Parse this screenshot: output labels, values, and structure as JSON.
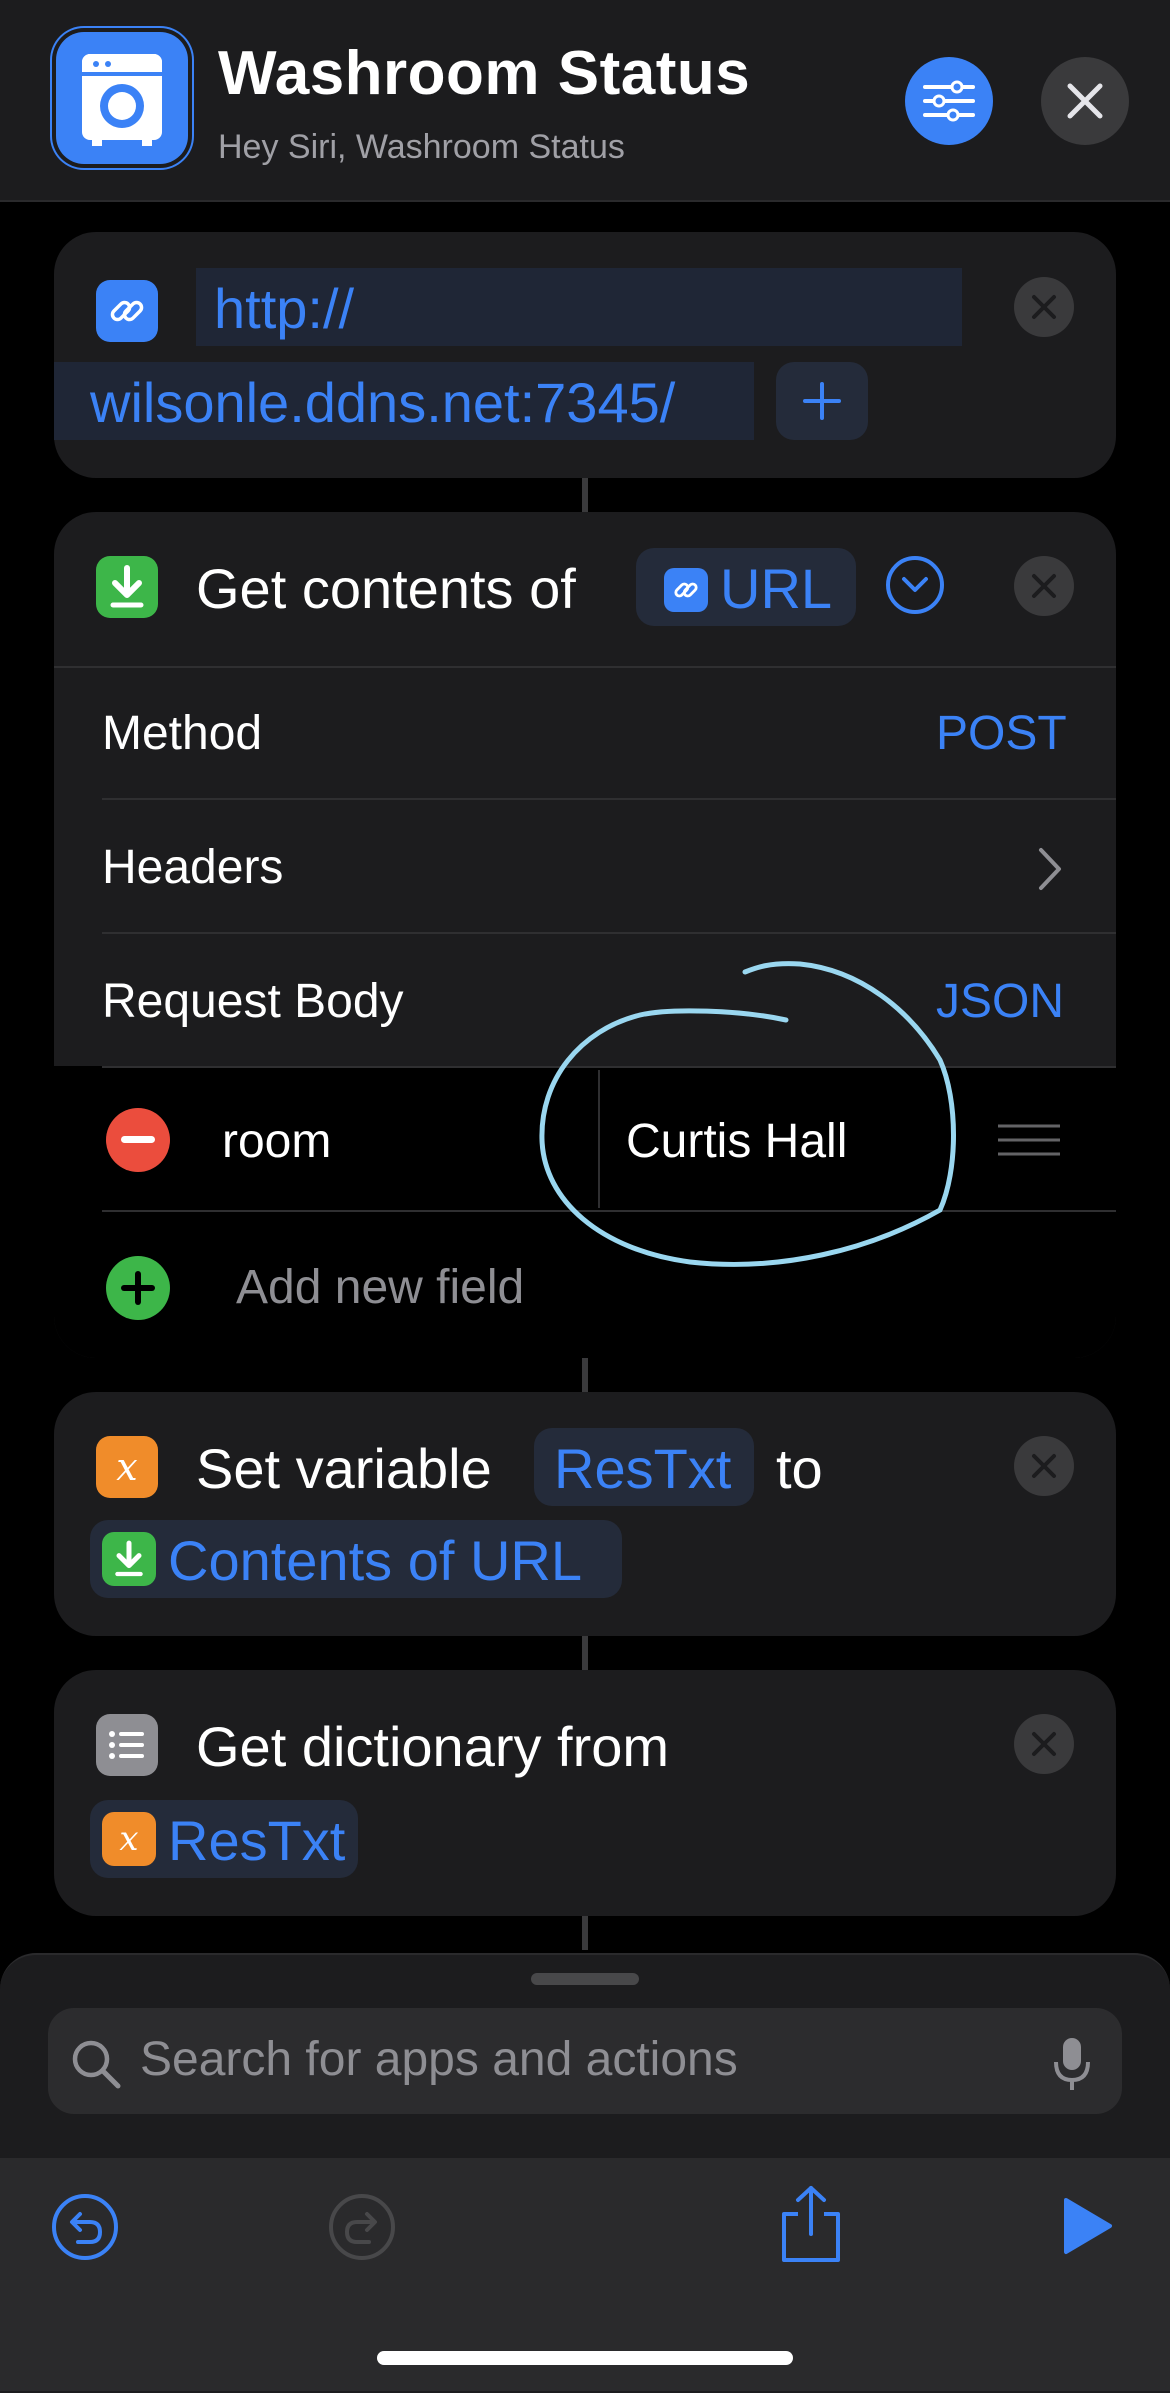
{
  "header": {
    "title": "Washroom Status",
    "subtitle": "Hey Siri, Washroom Status"
  },
  "url_action": {
    "line1": "http://",
    "line2": "wilsonle.ddns.net:7345/"
  },
  "get_contents": {
    "title": "Get contents of",
    "url_token": "URL",
    "method_label": "Method",
    "method_value": "POST",
    "headers_label": "Headers",
    "body_label": "Request Body",
    "body_value": "JSON",
    "fields": [
      {
        "key": "room",
        "value": "Curtis Hall"
      }
    ],
    "add_field": "Add new field"
  },
  "set_variable": {
    "title": "Set variable",
    "var_token": "ResTxt",
    "to": "to",
    "value_token": "Contents of URL"
  },
  "get_dictionary": {
    "title": "Get dictionary from",
    "var_token": "ResTxt"
  },
  "search": {
    "placeholder": "Search for apps and actions"
  },
  "colors": {
    "accent": "#3b82f6",
    "orange": "#f08c2a",
    "green": "#3db649",
    "red": "#eb4d3d",
    "annotation": "#9ad7f0"
  }
}
